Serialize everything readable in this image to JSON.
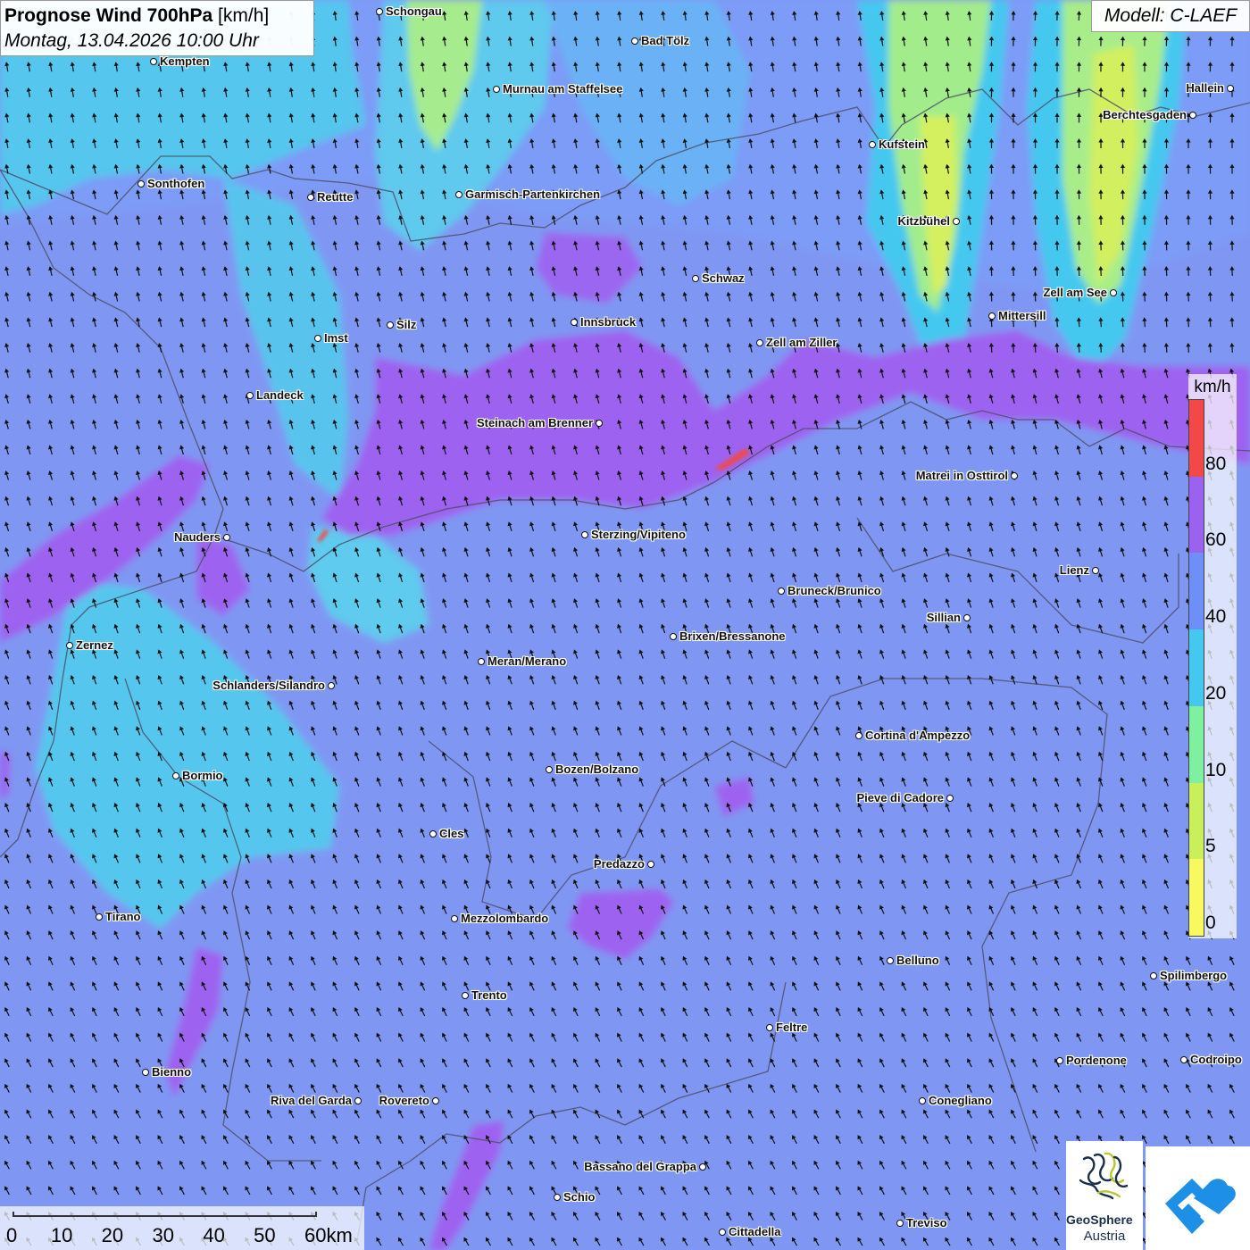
{
  "header": {
    "title_bold": "Prognose Wind 700hPa",
    "title_unit": "[km/h]",
    "datetime": "Montag, 13.04.2026 10:00 Uhr"
  },
  "model": {
    "label": "Modell: C-LAEF"
  },
  "legend": {
    "unit": "km/h",
    "classes": [
      {
        "label": "0",
        "color": "#f8f860"
      },
      {
        "label": "5",
        "color": "#c9f05a"
      },
      {
        "label": "10",
        "color": "#7ef0a0"
      },
      {
        "label": "20",
        "color": "#44c8f0"
      },
      {
        "label": "40",
        "color": "#6f8ff8"
      },
      {
        "label": "60",
        "color": "#9b62f0"
      },
      {
        "label": "80",
        "color": "#f24848"
      }
    ]
  },
  "scale": {
    "labels": [
      "0",
      "10",
      "20",
      "30",
      "40",
      "50",
      "60km"
    ]
  },
  "wind": {
    "dominant_direction": "from south (arrows pointing north-northwest)"
  },
  "cities": [
    {
      "name": "Schongau",
      "side": "right"
    },
    {
      "name": "Kempten",
      "side": "right"
    },
    {
      "name": "Bad Tölz",
      "side": "right"
    },
    {
      "name": "Murnau am Staffelsee",
      "side": "right"
    },
    {
      "name": "Hallein",
      "side": "left"
    },
    {
      "name": "Berchtesgaden",
      "side": "left"
    },
    {
      "name": "Kufstein",
      "side": "right"
    },
    {
      "name": "Sonthofen",
      "side": "right"
    },
    {
      "name": "Reutte",
      "side": "right"
    },
    {
      "name": "Garmisch-Partenkirchen",
      "side": "right"
    },
    {
      "name": "Kitzbühel",
      "side": "left"
    },
    {
      "name": "Schwaz",
      "side": "right"
    },
    {
      "name": "Zell am See",
      "side": "left"
    },
    {
      "name": "Innsbruck",
      "side": "right"
    },
    {
      "name": "Mittersill",
      "side": "right"
    },
    {
      "name": "Silz",
      "side": "right"
    },
    {
      "name": "Imst",
      "side": "right"
    },
    {
      "name": "Zell am Ziller",
      "side": "right"
    },
    {
      "name": "Landeck",
      "side": "right"
    },
    {
      "name": "Steinach am Brenner",
      "side": "left"
    },
    {
      "name": "Matrei in Osttirol",
      "side": "left"
    },
    {
      "name": "Nauders",
      "side": "left"
    },
    {
      "name": "Sterzing/Vipiteno",
      "side": "right"
    },
    {
      "name": "Lienz",
      "side": "left"
    },
    {
      "name": "Bruneck/Brunico",
      "side": "right"
    },
    {
      "name": "Sillian",
      "side": "left"
    },
    {
      "name": "Zernez",
      "side": "right"
    },
    {
      "name": "Brixen/Bressanone",
      "side": "right"
    },
    {
      "name": "Meran/Merano",
      "side": "right"
    },
    {
      "name": "Schlanders/Silandro",
      "side": "left"
    },
    {
      "name": "Cortina d'Ampezzo",
      "side": "right"
    },
    {
      "name": "Bozen/Bolzano",
      "side": "right"
    },
    {
      "name": "Bormio",
      "side": "right"
    },
    {
      "name": "Pieve di Cadore",
      "side": "left"
    },
    {
      "name": "Cles",
      "side": "right"
    },
    {
      "name": "Predazzo",
      "side": "left"
    },
    {
      "name": "Tirano",
      "side": "right"
    },
    {
      "name": "Mezzolombardo",
      "side": "right"
    },
    {
      "name": "Belluno",
      "side": "right"
    },
    {
      "name": "Spilimbergo",
      "side": "right"
    },
    {
      "name": "Trento",
      "side": "right"
    },
    {
      "name": "Feltre",
      "side": "right"
    },
    {
      "name": "Pordenone",
      "side": "right"
    },
    {
      "name": "Codroipo",
      "side": "right"
    },
    {
      "name": "Bienno",
      "side": "right"
    },
    {
      "name": "Riva del Garda",
      "side": "left"
    },
    {
      "name": "Rovereto",
      "side": "left"
    },
    {
      "name": "Conegliano",
      "side": "right"
    },
    {
      "name": "Bassano del Grappa",
      "side": "left"
    },
    {
      "name": "Schio",
      "side": "right"
    },
    {
      "name": "Treviso",
      "side": "right"
    },
    {
      "name": "Cittadella",
      "side": "right"
    }
  ],
  "logos": {
    "geosphere_name": "GeoSphere",
    "geosphere_country": "Austria"
  }
}
